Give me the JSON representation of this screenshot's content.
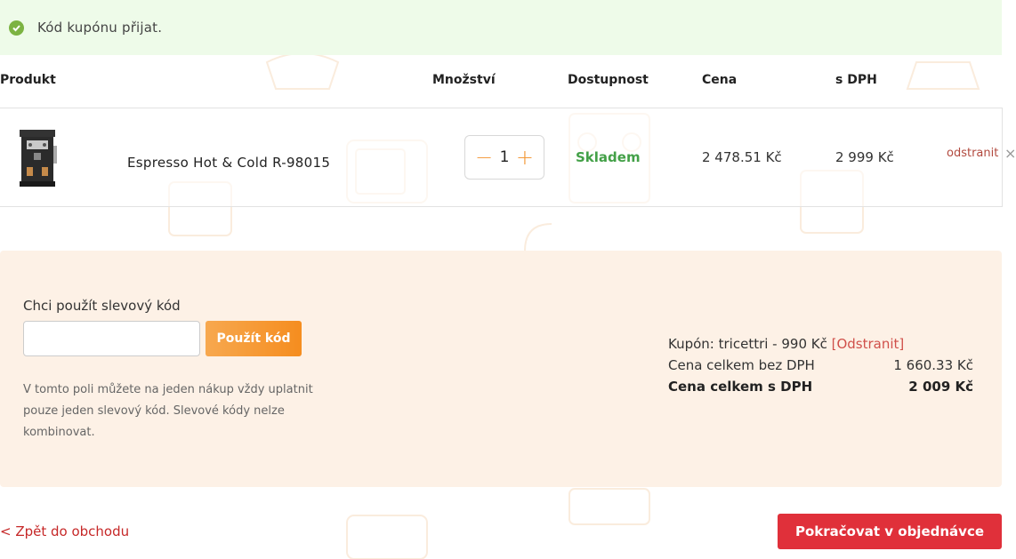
{
  "alert": {
    "message": "Kód kupónu přijat.",
    "icon": "check-circle-icon",
    "color": "#7cb342"
  },
  "table": {
    "headers": {
      "product": "Produkt",
      "quantity": "Množství",
      "availability": "Dostupnost",
      "price": "Cena",
      "price_vat": "s DPH"
    }
  },
  "item": {
    "name": "Espresso Hot & Cold R-98015",
    "quantity": "1",
    "availability": "Skladem",
    "price": "2 478.51 Kč",
    "price_vat": "2 999 Kč",
    "remove_label": "odstranit",
    "remove_icon": "×"
  },
  "coupon": {
    "label": "Chci použít slevový kód",
    "input_value": "",
    "apply_label": "Použít kód",
    "note": "V tomto poli můžete na jeden nákup vždy uplatnit pouze jeden slevový kód. Slevové kódy nelze kombinovat."
  },
  "summary": {
    "coupon_text": "Kupón: tricettri - 990 Kč",
    "coupon_remove": "[Odstranit]",
    "subtotal_label": "Cena celkem bez DPH",
    "subtotal_value": "1 660.33 Kč",
    "total_label": "Cena celkem s DPH",
    "total_value": "2 009 Kč"
  },
  "footer": {
    "back_label": "< Zpět do obchodu",
    "continue_label": "Pokračovat v objednávce"
  },
  "colors": {
    "accent_orange": "#f58d1f",
    "accent_red": "#e0303a",
    "in_stock_green": "#43a047",
    "panel_bg": "#fdf1e6",
    "alert_bg": "#eefbe9"
  }
}
